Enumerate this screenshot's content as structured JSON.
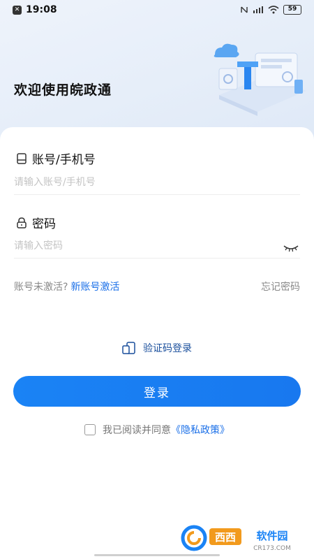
{
  "status_bar": {
    "time": "19:08",
    "battery": "59",
    "network_icons": [
      "nfc-icon",
      "signal-icon",
      "wifi-icon"
    ]
  },
  "header": {
    "welcome_text": "欢迎使用皖政通"
  },
  "form": {
    "account_label": "账号/手机号",
    "account_placeholder": "请输入账号/手机号",
    "password_label": "密码",
    "password_placeholder": "请输入密码"
  },
  "links": {
    "not_activated": "账号未激活?",
    "activate_new": "新账号激活",
    "forgot_password": "忘记密码"
  },
  "actions": {
    "code_login": "验证码登录",
    "login_button": "登录"
  },
  "agreement": {
    "text": "我已阅读并同意",
    "policy": "《隐私政策》"
  },
  "watermark": {
    "brand": "西西软件园",
    "site": "CR173.COM"
  },
  "colors": {
    "accent": "#1a83f5",
    "link": "#1a6fe8"
  }
}
